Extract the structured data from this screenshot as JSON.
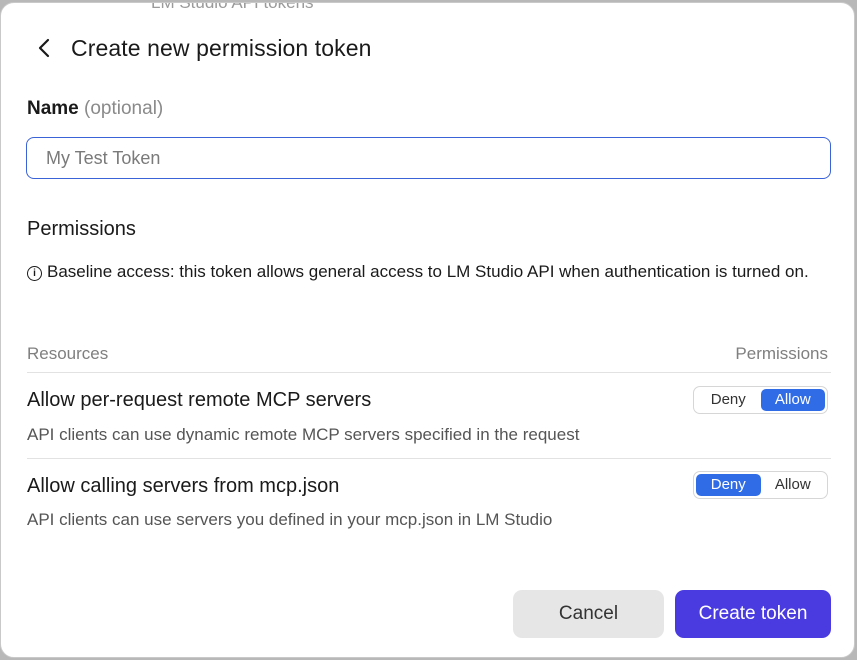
{
  "background_text": "LM Studio API tokens",
  "header": {
    "title": "Create new permission token"
  },
  "name_field": {
    "label": "Name",
    "optional_hint": "(optional)",
    "placeholder": "My Test Token",
    "value": ""
  },
  "permissions": {
    "heading": "Permissions",
    "notice_icon": "info-circle-icon",
    "notice": "Baseline access: this token allows general access to LM Studio API when authentication is turned on.",
    "col_resources": "Resources",
    "col_permissions": "Permissions",
    "rows": [
      {
        "title": "Allow per-request remote MCP servers",
        "description": "API clients can use dynamic remote MCP servers specified in the request",
        "deny_label": "Deny",
        "allow_label": "Allow",
        "selected": "Allow"
      },
      {
        "title": "Allow calling servers from mcp.json",
        "description": "API clients can use servers you defined in your mcp.json in LM Studio",
        "deny_label": "Deny",
        "allow_label": "Allow",
        "selected": "Deny"
      }
    ]
  },
  "footer": {
    "cancel_label": "Cancel",
    "create_label": "Create token"
  },
  "colors": {
    "accent_blue": "#2f6ce6",
    "primary_button": "#4a3be0",
    "input_focus_border": "#3b63d8"
  }
}
